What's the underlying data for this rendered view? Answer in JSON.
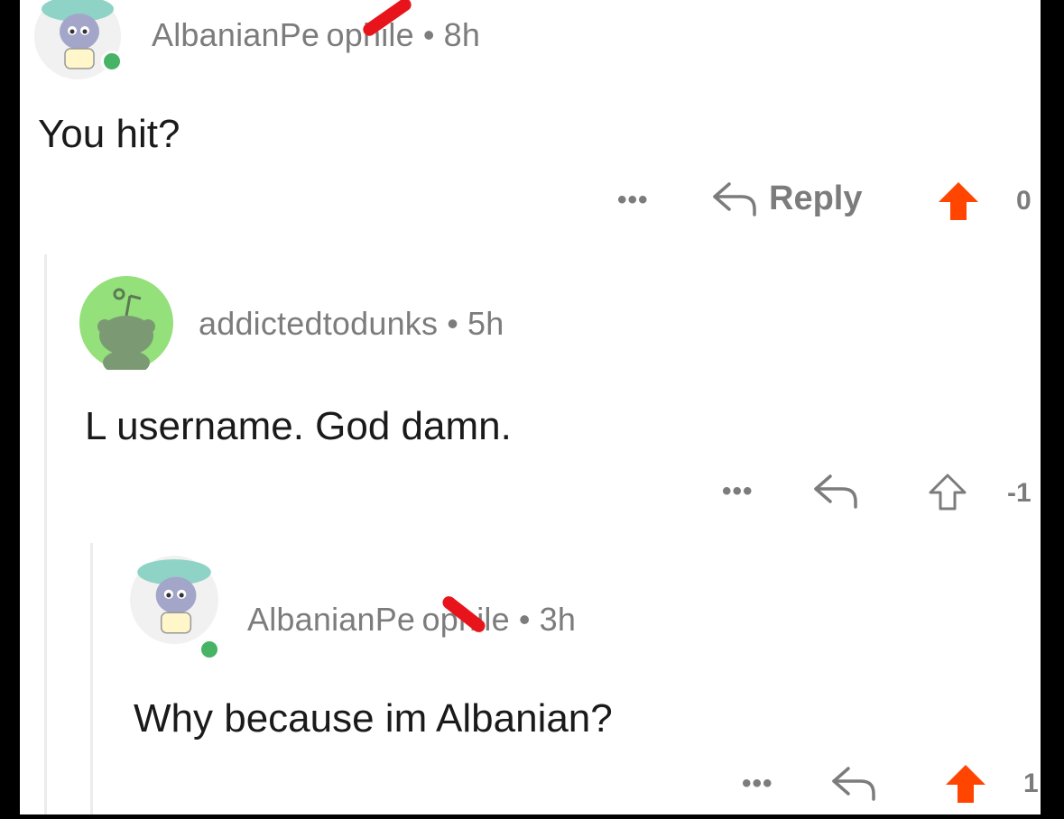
{
  "colors": {
    "upvote_active": "#ff4500",
    "meta_gray": "#7c7c7c",
    "online": "#46b464",
    "redaction": "#e8141b"
  },
  "comments": [
    {
      "username": "AlbanianPe ophile",
      "separator": "•",
      "time": "8h",
      "body": "You hit?",
      "more": "•••",
      "reply_label": "Reply",
      "score": "0",
      "upvoted": true,
      "avatar_icon": "snoo-avatar-icon"
    },
    {
      "username": "addictedtodunks",
      "separator": "•",
      "time": "5h",
      "body": "L username.  God damn.",
      "more": "•••",
      "score": "-1",
      "upvoted": false,
      "avatar_icon": "default-snoo-icon"
    },
    {
      "username": "AlbanianPe ophile",
      "separator": "•",
      "time": "3h",
      "body": "Why because im Albanian?",
      "more": "•••",
      "score": "1",
      "upvoted": true,
      "avatar_icon": "snoo-avatar-icon"
    }
  ]
}
